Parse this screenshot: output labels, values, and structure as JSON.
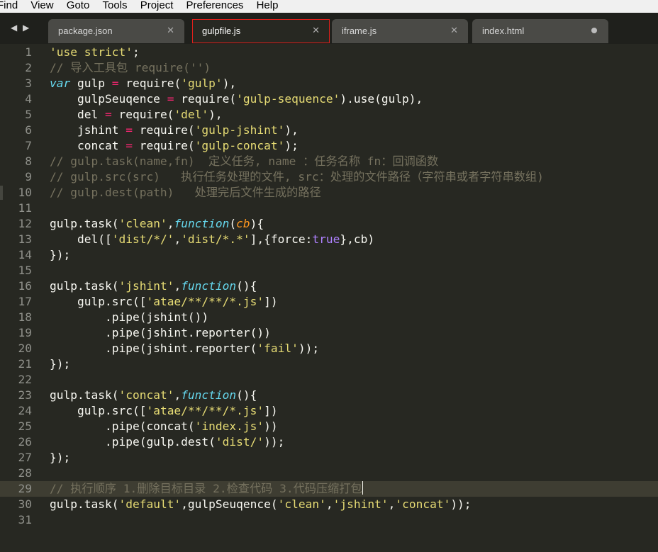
{
  "menu": [
    "Find",
    "View",
    "Goto",
    "Tools",
    "Project",
    "Preferences",
    "Help"
  ],
  "tabs": [
    {
      "label": "package.json",
      "state": "close"
    },
    {
      "label": "gulpfile.js",
      "state": "close",
      "active": true
    },
    {
      "label": "iframe.js",
      "state": "close"
    },
    {
      "label": "index.html",
      "state": "dirty"
    }
  ],
  "icons": {
    "nav_left": "◀",
    "nav_right": "▶",
    "close": "✕",
    "dirty": "dirty-dot-icon"
  },
  "editor": {
    "current_line": 29,
    "lines": [
      {
        "n": "1",
        "t": [
          [
            "s",
            "'use strict'"
          ],
          [
            "",
            "; "
          ]
        ]
      },
      {
        "n": "2",
        "t": [
          [
            "c",
            "// 导入工具包 require('')"
          ]
        ]
      },
      {
        "n": "3",
        "t": [
          [
            "k",
            "var"
          ],
          [
            "",
            " gulp "
          ],
          [
            "o",
            "="
          ],
          [
            "",
            " require("
          ],
          [
            "s",
            "'gulp'"
          ],
          [
            "",
            "),"
          ]
        ]
      },
      {
        "n": "4",
        "t": [
          [
            "",
            "    gulpSeuqence "
          ],
          [
            "o",
            "="
          ],
          [
            "",
            " require("
          ],
          [
            "s",
            "'gulp-sequence'"
          ],
          [
            "",
            ").use(gulp),"
          ]
        ]
      },
      {
        "n": "5",
        "t": [
          [
            "",
            "    del "
          ],
          [
            "o",
            "="
          ],
          [
            "",
            " require("
          ],
          [
            "s",
            "'del'"
          ],
          [
            "",
            "),"
          ]
        ]
      },
      {
        "n": "6",
        "t": [
          [
            "",
            "    jshint "
          ],
          [
            "o",
            "="
          ],
          [
            "",
            " require("
          ],
          [
            "s",
            "'gulp-jshint'"
          ],
          [
            "",
            "),"
          ]
        ]
      },
      {
        "n": "7",
        "t": [
          [
            "",
            "    concat "
          ],
          [
            "o",
            "="
          ],
          [
            "",
            " require("
          ],
          [
            "s",
            "'gulp-concat'"
          ],
          [
            "",
            ");"
          ]
        ]
      },
      {
        "n": "8",
        "t": [
          [
            "c",
            "// gulp.task(name,fn)  定义任务, name ：任务名称 fn：回调函数"
          ]
        ]
      },
      {
        "n": "9",
        "t": [
          [
            "c",
            "// gulp.src(src)   执行任务处理的文件, src：处理的文件路径（字符串或者字符串数组)"
          ]
        ]
      },
      {
        "n": "10",
        "t": [
          [
            "c",
            "// gulp.dest(path)   处理完后文件生成的路径"
          ]
        ]
      },
      {
        "n": "11",
        "t": []
      },
      {
        "n": "12",
        "t": [
          [
            "",
            "gulp.task("
          ],
          [
            "s",
            "'clean'"
          ],
          [
            "",
            ","
          ],
          [
            "f",
            "function"
          ],
          [
            "",
            "("
          ],
          [
            "p",
            "cb"
          ],
          [
            "",
            "){"
          ]
        ]
      },
      {
        "n": "13",
        "t": [
          [
            "",
            "    del(["
          ],
          [
            "s",
            "'dist/*/'"
          ],
          [
            "",
            ","
          ],
          [
            "s",
            "'dist/*.*'"
          ],
          [
            "",
            "],{force:"
          ],
          [
            "b",
            "true"
          ],
          [
            "",
            "},cb)"
          ]
        ]
      },
      {
        "n": "14",
        "t": [
          [
            "",
            "});"
          ]
        ]
      },
      {
        "n": "15",
        "t": []
      },
      {
        "n": "16",
        "t": [
          [
            "",
            "gulp.task("
          ],
          [
            "s",
            "'jshint'"
          ],
          [
            "",
            ","
          ],
          [
            "f",
            "function"
          ],
          [
            "",
            "(){"
          ]
        ]
      },
      {
        "n": "17",
        "t": [
          [
            "",
            "    gulp.src(["
          ],
          [
            "s",
            "'atae/**/**/*.js'"
          ],
          [
            "",
            "])"
          ]
        ]
      },
      {
        "n": "18",
        "t": [
          [
            "",
            "        .pipe(jshint())"
          ]
        ]
      },
      {
        "n": "19",
        "t": [
          [
            "",
            "        .pipe(jshint.reporter())"
          ]
        ]
      },
      {
        "n": "20",
        "t": [
          [
            "",
            "        .pipe(jshint.reporter("
          ],
          [
            "s",
            "'fail'"
          ],
          [
            "",
            "));"
          ]
        ]
      },
      {
        "n": "21",
        "t": [
          [
            "",
            "});"
          ]
        ]
      },
      {
        "n": "22",
        "t": []
      },
      {
        "n": "23",
        "t": [
          [
            "",
            "gulp.task("
          ],
          [
            "s",
            "'concat'"
          ],
          [
            "",
            ","
          ],
          [
            "f",
            "function"
          ],
          [
            "",
            "(){"
          ]
        ]
      },
      {
        "n": "24",
        "t": [
          [
            "",
            "    gulp.src(["
          ],
          [
            "s",
            "'atae/**/**/*.js'"
          ],
          [
            "",
            "])"
          ]
        ]
      },
      {
        "n": "25",
        "t": [
          [
            "",
            "        .pipe(concat("
          ],
          [
            "s",
            "'index.js'"
          ],
          [
            "",
            "))"
          ]
        ]
      },
      {
        "n": "26",
        "t": [
          [
            "",
            "        .pipe(gulp.dest("
          ],
          [
            "s",
            "'dist/'"
          ],
          [
            "",
            "));"
          ]
        ]
      },
      {
        "n": "27",
        "t": [
          [
            "",
            "});"
          ]
        ]
      },
      {
        "n": "28",
        "t": []
      },
      {
        "n": "29",
        "t": [
          [
            "c",
            "// 执行顺序 1.删除目标目录 2.检查代码 3.代码压缩打包"
          ]
        ]
      },
      {
        "n": "30",
        "t": [
          [
            "",
            "gulp.task("
          ],
          [
            "s",
            "'default'"
          ],
          [
            "",
            ",gulpSeuqence("
          ],
          [
            "s",
            "'clean'"
          ],
          [
            "",
            ","
          ],
          [
            "s",
            "'jshint'"
          ],
          [
            "",
            ","
          ],
          [
            "s",
            "'concat'"
          ],
          [
            "",
            "));"
          ]
        ]
      },
      {
        "n": "31",
        "t": []
      }
    ]
  }
}
